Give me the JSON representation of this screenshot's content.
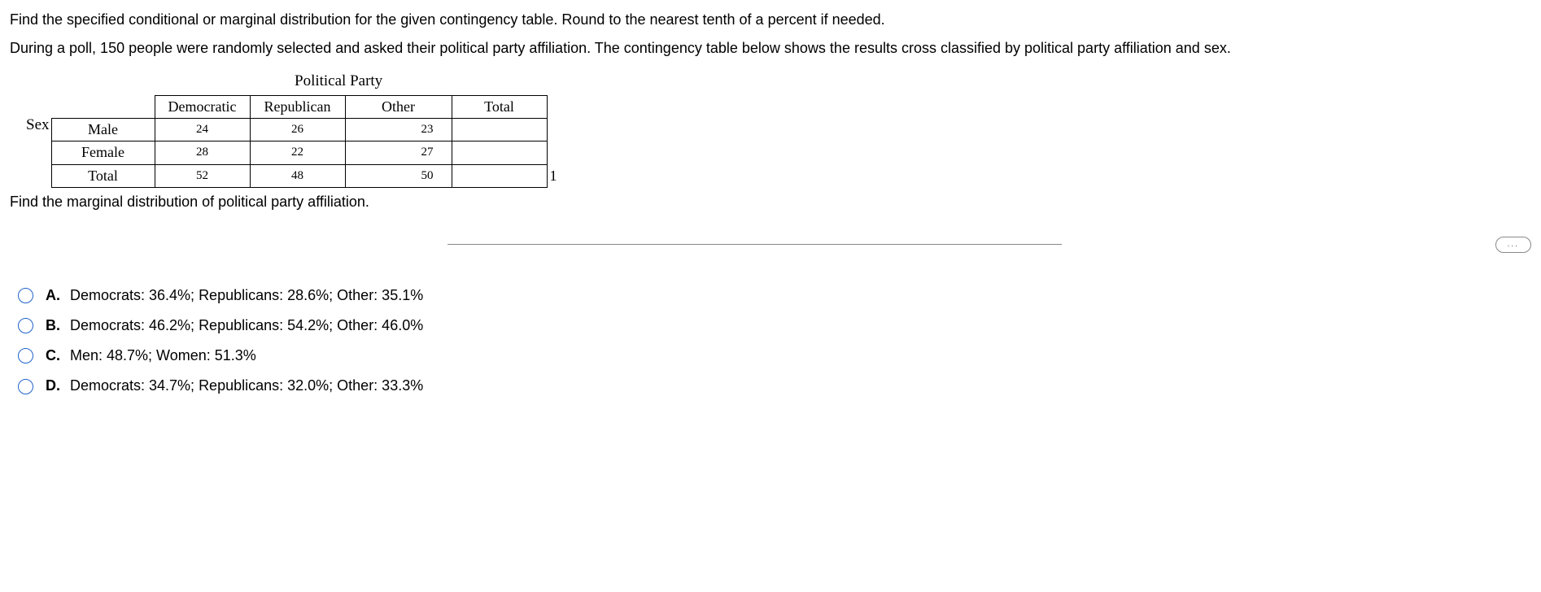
{
  "question": {
    "instruction": "Find the  specified conditional or marginal distribution for the given contingency table. Round to the nearest tenth of a percent if needed.",
    "context": "During a poll, 150 people were randomly selected and asked their political party affiliation. The contingency table below shows the results cross classified by political party affiliation and sex.",
    "subquestion": "Find the marginal distribution of political party affiliation."
  },
  "table": {
    "title": "Political Party",
    "row_group_label": "Sex",
    "headers": {
      "c1": "Democratic",
      "c2": "Republican",
      "c3": "Other",
      "c4": "Total"
    },
    "rows": {
      "r1": {
        "label": "Male",
        "c1": "24",
        "c2": "26",
        "c3": "23",
        "c4": ""
      },
      "r2": {
        "label": "Female",
        "c1": "28",
        "c2": "22",
        "c3": "27",
        "c4": ""
      },
      "r3": {
        "label": "Total",
        "c1": "52",
        "c2": "48",
        "c3": "50",
        "c4": ""
      }
    },
    "trailing_mark": "1"
  },
  "expand": "...",
  "options": {
    "a": {
      "letter": "A.",
      "text": "Democrats: 36.4%; Republicans: 28.6%; Other: 35.1%"
    },
    "b": {
      "letter": "B.",
      "text": "Democrats: 46.2%; Republicans: 54.2%; Other: 46.0%"
    },
    "c": {
      "letter": "C.",
      "text": "Men: 48.7%; Women: 51.3%"
    },
    "d": {
      "letter": "D.",
      "text": "Democrats: 34.7%; Republicans: 32.0%; Other: 33.3%"
    }
  }
}
